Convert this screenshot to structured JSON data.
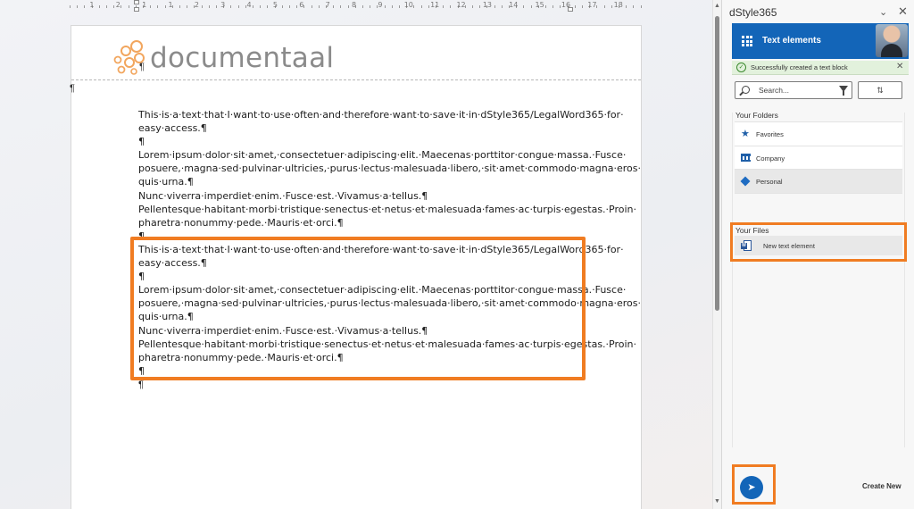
{
  "document": {
    "logo_text": "documentaal",
    "pilcrow": "¶",
    "block1": [
      "This·is·a·text·that·I·want·to·use·often·and·therefore·want·to·save·it·in·dStyle365/LegalWord365·for·",
      "easy·access.¶",
      "¶",
      "Lorem·ipsum·dolor·sit·amet,·consectetuer·adipiscing·elit.·Maecenas·porttitor·congue·massa.·Fusce·",
      "posuere,·magna·sed·pulvinar·ultricies,·purus·lectus·malesuada·libero,·sit·amet·commodo·magna·eros·",
      "quis·urna.¶",
      "Nunc·viverra·imperdiet·enim.·Fusce·est.·Vivamus·a·tellus.¶",
      "Pellentesque·habitant·morbi·tristique·senectus·et·netus·et·malesuada·fames·ac·turpis·egestas.·Proin·",
      "pharetra·nonummy·pede.·Mauris·et·orci.¶",
      "¶"
    ],
    "block2": [
      "This·is·a·text·that·I·want·to·use·often·and·therefore·want·to·save·it·in·dStyle365/LegalWord365·for·",
      "easy·access.¶",
      "¶",
      "Lorem·ipsum·dolor·sit·amet,·consectetuer·adipiscing·elit.·Maecenas·porttitor·congue·massa.·Fusce·",
      "posuere,·magna·sed·pulvinar·ultricies,·purus·lectus·malesuada·libero,·sit·amet·commodo·magna·eros·",
      "quis·urna.¶",
      "Nunc·viverra·imperdiet·enim.·Fusce·est.·Vivamus·a·tellus.¶",
      "Pellentesque·habitant·morbi·tristique·senectus·et·netus·et·malesuada·fames·ac·turpis·egestas.·Proin·",
      "pharetra·nonummy·pede.·Mauris·et·orci.¶",
      "¶"
    ],
    "trailing": "¶",
    "ruler_numbers": [
      "1",
      "2",
      "1",
      "1",
      "2",
      "3",
      "4",
      "5",
      "6",
      "7",
      "8",
      "9",
      "10",
      "11",
      "12",
      "13",
      "14",
      "15",
      "16",
      "17",
      "18"
    ]
  },
  "pane": {
    "title": "dStyle365",
    "chevron_glyph": "⌄",
    "close_glyph": "✕",
    "header_title": "Text elements",
    "toast": {
      "icon": "✓",
      "text": "Successfully created a text block",
      "close_glyph": "✕"
    },
    "search": {
      "placeholder": "Search..."
    },
    "sort_glyph": "⇅",
    "folders_label": "Your Folders",
    "folders": [
      {
        "label": "Favorites",
        "icon": "star-icon",
        "glyph": "★"
      },
      {
        "label": "Company",
        "icon": "bank-icon",
        "glyph": ""
      },
      {
        "label": "Personal",
        "icon": "cube-icon",
        "glyph": ""
      }
    ],
    "files_label": "Your Files",
    "files": [
      {
        "label": "New text element",
        "icon": "word-document-icon",
        "glyph": "W"
      }
    ],
    "send_glyph": "➤",
    "create_new_label": "Create New"
  },
  "colors": {
    "accent": "#1365b8",
    "highlight": "#f07c22",
    "toast_bg": "#e2f1dc"
  }
}
